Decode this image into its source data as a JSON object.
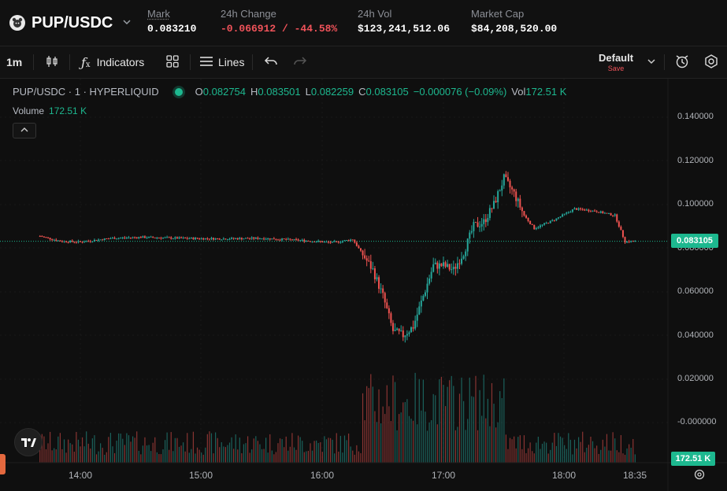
{
  "header": {
    "pair": "PUP/USDC",
    "stats": [
      {
        "label": "Mark",
        "value": "0.083210",
        "tone": "neutral"
      },
      {
        "label": "24h Change",
        "value": "-0.066912 / -44.58%",
        "tone": "negative"
      },
      {
        "label": "24h Vol",
        "value": "$123,241,512.06",
        "tone": "neutral"
      },
      {
        "label": "Market Cap",
        "value": "$84,208,520.00",
        "tone": "neutral"
      }
    ]
  },
  "toolbar": {
    "interval": "1m",
    "indicators_label": "Indicators",
    "lines_label": "Lines",
    "layout_name": "Default",
    "layout_save": "Save"
  },
  "legend": {
    "symbol": "PUP/USDC · 1 · HYPERLIQUID",
    "o_label": "O",
    "o": "0.082754",
    "h_label": "H",
    "h": "0.083501",
    "l_label": "L",
    "l": "0.082259",
    "c_label": "C",
    "c": "0.083105",
    "change": "−0.000076 (−0.09%)",
    "vol_label": "Vol",
    "vol": "172.51 K"
  },
  "volume_legend": {
    "label": "Volume",
    "value": "172.51 K"
  },
  "price_tag": "0.083105",
  "volume_tag": "172.51 K",
  "y_ticks": [
    "0.140000",
    "0.120000",
    "0.100000",
    "0.080000",
    "0.060000",
    "0.040000",
    "0.020000",
    "-0.000000"
  ],
  "x_ticks": [
    "14:00",
    "15:00",
    "16:00",
    "17:00",
    "18:00",
    "18:35"
  ],
  "colors": {
    "up": "#26a69a",
    "down": "#ef5350",
    "accent": "#1db88f",
    "negative": "#f0535a"
  },
  "icons": [
    "pup-logo-icon",
    "chevron-down-icon",
    "candle-type-icon",
    "fx-icon",
    "layouts-grid-icon",
    "lines-icon",
    "undo-icon",
    "redo-icon",
    "chevron-down-icon",
    "alert-icon",
    "settings-icon",
    "tradingview-logo-icon"
  ],
  "chart_data": {
    "type": "candlestick",
    "ylim": [
      -0.005,
      0.15
    ],
    "price_path": [
      {
        "t": "13:40",
        "price": 0.0855
      },
      {
        "t": "13:50",
        "price": 0.0832
      },
      {
        "t": "14:00",
        "price": 0.0828
      },
      {
        "t": "14:15",
        "price": 0.0845
      },
      {
        "t": "14:30",
        "price": 0.085
      },
      {
        "t": "14:50",
        "price": 0.0845
      },
      {
        "t": "15:10",
        "price": 0.0843
      },
      {
        "t": "15:30",
        "price": 0.0845
      },
      {
        "t": "15:50",
        "price": 0.0835
      },
      {
        "t": "16:05",
        "price": 0.0825
      },
      {
        "t": "16:15",
        "price": 0.084
      },
      {
        "t": "16:25",
        "price": 0.07
      },
      {
        "t": "16:30",
        "price": 0.058
      },
      {
        "t": "16:35",
        "price": 0.042
      },
      {
        "t": "16:40",
        "price": 0.04
      },
      {
        "t": "16:45",
        "price": 0.044
      },
      {
        "t": "16:50",
        "price": 0.058
      },
      {
        "t": "16:55",
        "price": 0.072
      },
      {
        "t": "17:00",
        "price": 0.072
      },
      {
        "t": "17:05",
        "price": 0.07
      },
      {
        "t": "17:10",
        "price": 0.078
      },
      {
        "t": "17:15",
        "price": 0.09
      },
      {
        "t": "17:20",
        "price": 0.092
      },
      {
        "t": "17:25",
        "price": 0.1
      },
      {
        "t": "17:30",
        "price": 0.112
      },
      {
        "t": "17:35",
        "price": 0.105
      },
      {
        "t": "17:40",
        "price": 0.095
      },
      {
        "t": "17:45",
        "price": 0.089
      },
      {
        "t": "17:55",
        "price": 0.093
      },
      {
        "t": "18:05",
        "price": 0.098
      },
      {
        "t": "18:15",
        "price": 0.097
      },
      {
        "t": "18:25",
        "price": 0.095
      },
      {
        "t": "18:30",
        "price": 0.083
      },
      {
        "t": "18:35",
        "price": 0.0831
      }
    ]
  }
}
